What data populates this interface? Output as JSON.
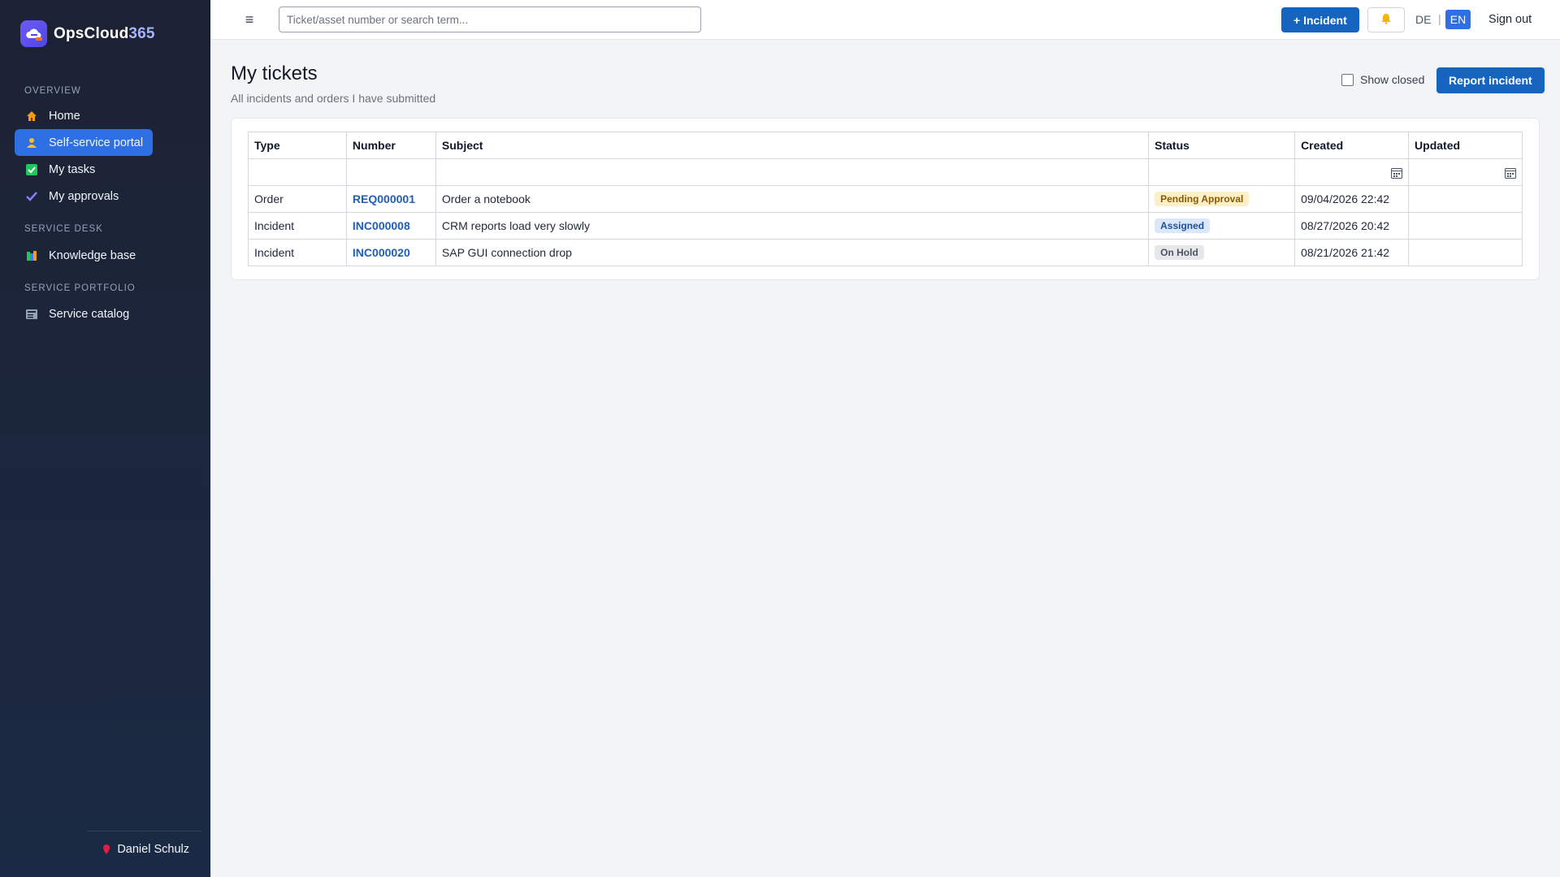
{
  "brand": {
    "name": "OpsCloud",
    "suffix": "365"
  },
  "sidebar": {
    "sections": [
      {
        "label": "OVERVIEW"
      },
      {
        "label": "SERVICE DESK"
      },
      {
        "label": "SERVICE PORTFOLIO"
      }
    ],
    "items": [
      {
        "label": "Home",
        "icon": "home-icon"
      },
      {
        "label": "Self-service portal",
        "icon": "person-icon",
        "active": true
      },
      {
        "label": "My tasks",
        "icon": "checkbox-icon"
      },
      {
        "label": "My approvals",
        "icon": "checkmark-icon"
      },
      {
        "label": "Knowledge base",
        "icon": "books-icon"
      },
      {
        "label": "Service catalog",
        "icon": "catalog-icon"
      }
    ],
    "user": {
      "name": "Daniel Schulz",
      "icon": "pin-icon"
    }
  },
  "topbar": {
    "search_placeholder": "Ticket/asset number or search term...",
    "new_incident_label": "+ Incident",
    "lang_de": "DE",
    "lang_sep": "|",
    "lang_en": "EN",
    "signout_label": "Sign out"
  },
  "page": {
    "title": "My tickets",
    "subtitle": "All incidents and orders I have submitted",
    "show_closed_label": "Show closed",
    "show_closed_checked": false,
    "report_button_label": "Report incident"
  },
  "table": {
    "columns": [
      "Type",
      "Number",
      "Subject",
      "Status",
      "Created",
      "Updated"
    ],
    "rows": [
      {
        "type": "Order",
        "number": "REQ000001",
        "subject": "Order a notebook",
        "status": "Pending Approval",
        "created": "09/04/2026 22:42",
        "updated": ""
      },
      {
        "type": "Incident",
        "number": "INC000008",
        "subject": "CRM reports load very slowly",
        "status": "Assigned",
        "created": "08/27/2026 20:42",
        "updated": ""
      },
      {
        "type": "Incident",
        "number": "INC000020",
        "subject": "SAP GUI connection drop",
        "status": "On Hold",
        "created": "08/21/2026 21:42",
        "updated": ""
      }
    ]
  },
  "colors": {
    "accent": "#2f6fe4",
    "primary_button": "#1565c0",
    "sidebar_bg": "#1c2233",
    "status_pending": "#fdefc8",
    "status_assigned": "#dbe7fb",
    "status_hold": "#e5e7eb"
  }
}
